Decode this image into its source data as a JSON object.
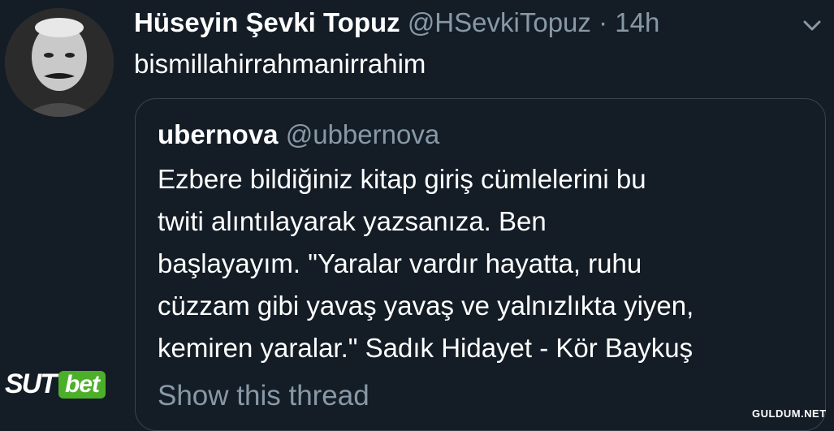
{
  "tweet": {
    "display_name": "Hüseyin Şevki Topuz",
    "handle": "@HSevkiTopuz",
    "separator": "·",
    "time": "14h",
    "text": "bismillahirrahmanirrahim",
    "avatar_icon": "avatar-photo-icon"
  },
  "quoted_tweet": {
    "display_name": "ubernova",
    "handle": "@ubbernova",
    "lines": [
      "Ezbere bildiğiniz kitap giriş cümlelerini bu",
      "twiti alıntılayarak yazsanıza. Ben",
      "başlayayım. \"Yaralar vardır hayatta, ruhu",
      "cüzzam gibi yavaş yavaş ve yalnızlıkta yiyen,",
      "kemiren yaralar.\" Sadık Hidayet - Kör Baykuş"
    ],
    "show_thread": "Show this thread"
  },
  "overlay": {
    "logo_sut": "SUT",
    "logo_bet": "bet",
    "watermark": "GULDUM.NET"
  },
  "colors": {
    "background": "#141d26",
    "secondary_text": "#8899a6",
    "border": "#38444d",
    "bet_green": "#4caf2a"
  }
}
